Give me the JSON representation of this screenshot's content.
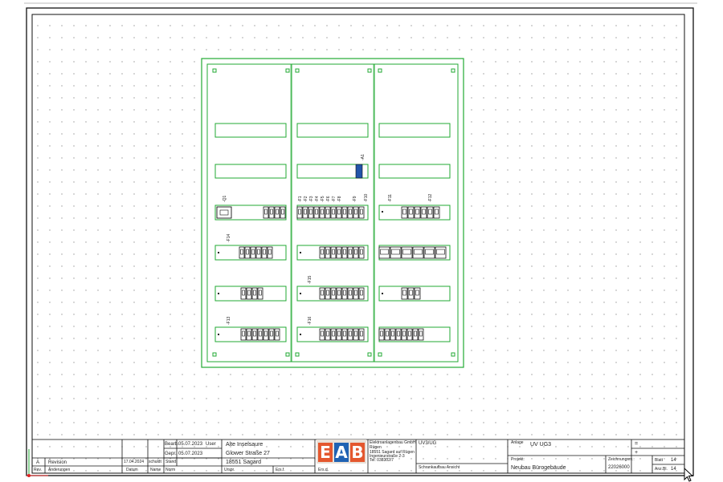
{
  "cabinet": {
    "rails_row1": [
      "Q1",
      "F9",
      "F11",
      "F12"
    ],
    "labels": {
      "q1": "-Q1",
      "a1": "-A1",
      "f1": "-F1",
      "f2": "-F2",
      "f3": "-F3",
      "f4": "-F4",
      "f5": "-F5",
      "f6": "-F6",
      "f7": "-F7",
      "f8": "-F8",
      "f9": "-F9",
      "f10": "-F10",
      "f11": "-F11",
      "f12": "-F12",
      "f13": "-F13",
      "f14": "-F14",
      "f15": "-F15",
      "f16": "-F16"
    }
  },
  "titleblock": {
    "bearb_label": "Bearb.",
    "bearb_date": "05.07.2023",
    "bearb_user": "User",
    "gepr_label": "Gepr.",
    "gepr_date": "05.07.2023",
    "address_line1": "Alte Inselsaure",
    "address_line2": "Glower Straße 27",
    "address_line3": "18551 Sagard",
    "logo_letters": [
      "E",
      "A",
      "B"
    ],
    "company_small_1": "Elektroanlagenbau GmbH",
    "company_small_2": "Rügen",
    "company_small_3": "18551 Sagard auf Rügen",
    "company_small_4": "Ingenieurstraße 2-3",
    "company_small_5": "Tel. 038302/7",
    "doc_code": "UV3/UG",
    "anlage_label": "Anlage",
    "anlage_value": "UV UG3",
    "plus": "+",
    "eq": "=",
    "revision_a": "A",
    "revision_label": "Revision",
    "revision_date": "17.04.2024",
    "revision_user": "schuldt",
    "stand_label": "Stand",
    "schrank_label": "Schrankaufbau Ansicht",
    "projekt_label": "Projekt:",
    "projekt_value": "Neubau Bürogebäude",
    "zeichnung_label": "Zeichnungsnr.:",
    "zeichnung_value": "22026000",
    "blatt_label": "Blatt",
    "blatt_value": "14",
    "anzahl_label": "Anz.Bl.",
    "anzahl_value": "14",
    "rev_label": "Rev.",
    "aenderungen_label": "Änderungen",
    "datum_label": "Datum",
    "name_label": "Name",
    "norm_label": "Norm",
    "urspr_label": "Urspr.",
    "ers_fuer_label": "Ers.f.",
    "ers_durch_label": "Ers.d."
  },
  "colors": {
    "green": "#22aa33",
    "frame": "#111111",
    "grid_dot": "#9a9a9a",
    "logo_orange": "#e4572e",
    "logo_blue": "#1f62b3",
    "red_mark": "#dd2222"
  }
}
